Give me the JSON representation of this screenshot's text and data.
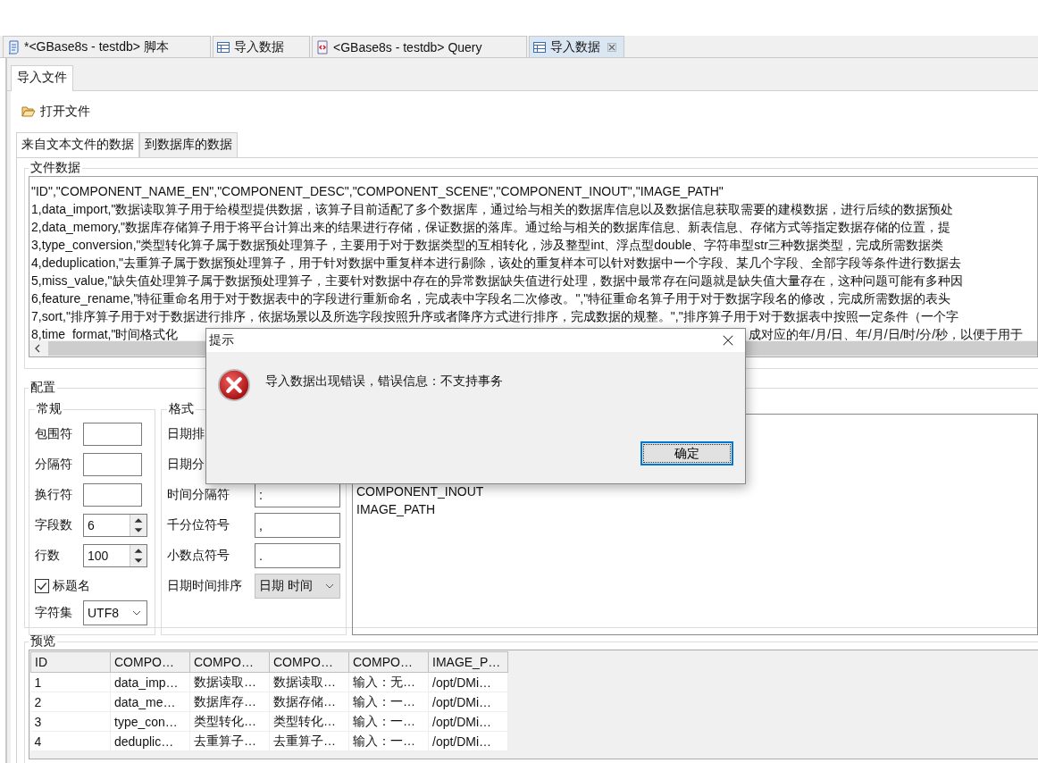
{
  "editor_tabs": [
    {
      "label": "*<GBase8s - testdb> 脚本",
      "kind": "script",
      "selected": false
    },
    {
      "label": "导入数据",
      "kind": "import",
      "selected": false
    },
    {
      "label": "<GBase8s - testdb> Query",
      "kind": "query",
      "selected": false
    },
    {
      "label": "导入数据",
      "kind": "import",
      "selected": true
    }
  ],
  "view_tabs": [
    {
      "label": "导入文件",
      "selected": true
    }
  ],
  "toolbar": {
    "open_file": "打开文件"
  },
  "data_tabs": [
    {
      "label": "来自文本文件的数据",
      "selected": true
    },
    {
      "label": "到数据库的数据",
      "selected": false
    }
  ],
  "file_data": {
    "title": "文件数据",
    "lines": [
      "\"ID\",\"COMPONENT_NAME_EN\",\"COMPONENT_DESC\",\"COMPONENT_SCENE\",\"COMPONENT_INOUT\",\"IMAGE_PATH\"",
      "1,data_import,\"数据读取算子用于给模型提供数据，该算子目前适配了多个数据库，通过给与相关的数据库信息以及数据信息获取需要的建模数据，进行后续的数据预处",
      "2,data_memory,\"数据库存储算子用于将平台计算出来的结果进行存储，保证数据的落库。通过给与相关的数据库信息、新表信息、存储方式等指定数据存储的位置，提",
      "3,type_conversion,\"类型转化算子属于数据预处理算子，主要用于对于数据类型的互相转化，涉及整型int、浮点型double、字符串型str三种数据类型，完成所需数据类",
      "4,deduplication,\"去重算子属于数据预处理算子，用于针对数据中重复样本进行剔除，该处的重复样本可以针对数据中一个字段、某几个字段、全部字段等条件进行数据去",
      "5,miss_value,\"缺失值处理算子属于数据预处理算子，主要针对数据中存在的异常数据缺失值进行处理，数据中最常存在问题就是缺失值大量存在，这种问题可能有多种因",
      "6,feature_rename,\"特征重命名用于对于数据表中的字段进行重新命名，完成表中字段名二次修改。\",\"特征重命名算子用于对于数据字段名的修改，完成所需数据的表头",
      "7,sort,\"排序算子用于对于数据进行排序，依据场景以及所选字段按照升序或者降序方式进行排序，完成数据的规整。\",\"排序算子用于对于数据表中按照一定条件（一个字"
    ],
    "covered_line": {
      "before": "8,time_format,\"时间格式化",
      "after": "成对应的年/月/日、年/月/日/时/分/秒，以便于用于"
    }
  },
  "config": {
    "title": "配置",
    "general": {
      "title": "常规",
      "fields": [
        {
          "kind": "text",
          "label": "包围符"
        },
        {
          "kind": "text",
          "label": "分隔符"
        },
        {
          "kind": "text",
          "label": "换行符"
        },
        {
          "kind": "spinner",
          "label": "字段数",
          "value": "6"
        },
        {
          "kind": "spinner",
          "label": "行数",
          "value": "100"
        },
        {
          "kind": "checkbox",
          "label": "标题名",
          "checked": true
        },
        {
          "kind": "select",
          "label": "字符集",
          "value": "UTF8"
        }
      ]
    },
    "format": {
      "title": "格式",
      "fields": [
        {
          "kind": "covered",
          "label": "日期排"
        },
        {
          "kind": "covered",
          "label": "日期分"
        },
        {
          "kind": "text",
          "label": "时间分隔符",
          "value": ":"
        },
        {
          "kind": "text",
          "label": "千分位符号",
          "value": ","
        },
        {
          "kind": "text",
          "label": "小数点符号",
          "value": "."
        },
        {
          "kind": "select",
          "label": "日期时间排序",
          "value": "日期 时间",
          "disabled": true
        }
      ]
    },
    "field_list": [
      "COMPONENT_INOUT",
      "IMAGE_PATH"
    ]
  },
  "preview": {
    "title": "预览",
    "columns": [
      "ID",
      "COMPO…",
      "COMPO…",
      "COMPO…",
      "COMPO…",
      "IMAGE_P…"
    ],
    "rows": [
      [
        "1",
        "data_imp…",
        "数据读取…",
        "数据读取…",
        "输入：无…",
        "/opt/DMi…"
      ],
      [
        "2",
        "data_me…",
        "数据库存…",
        "数据存储…",
        "输入：一…",
        "/opt/DMi…"
      ],
      [
        "3",
        "type_con…",
        "类型转化…",
        "类型转化…",
        "输入：一…",
        "/opt/DMi…"
      ],
      [
        "4",
        "deduplic…",
        "去重算子…",
        "去重算子…",
        "输入：一…",
        "/opt/DMi…"
      ]
    ]
  },
  "dialog": {
    "title": "提示",
    "kind": "error",
    "message": "导入数据出现错误，错误信息：不支持事务",
    "buttons": [
      {
        "label": "确定",
        "default": true
      }
    ]
  }
}
